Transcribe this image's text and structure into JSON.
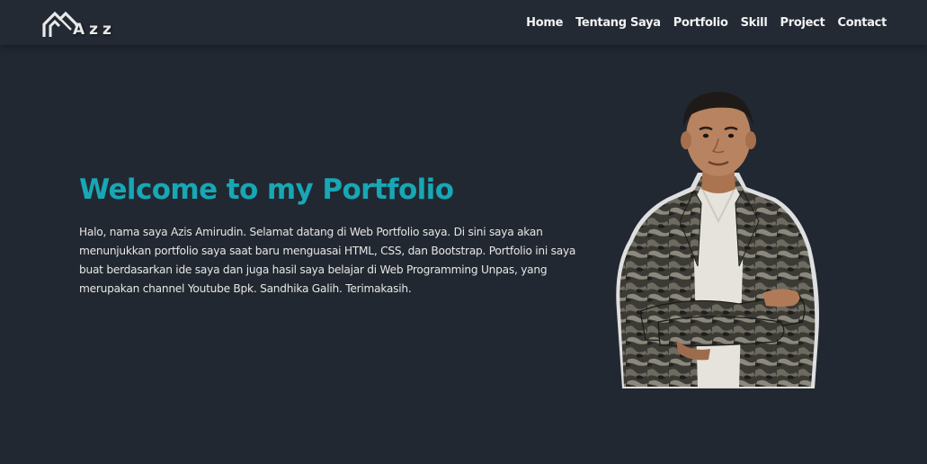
{
  "brand": {
    "text": "Azz",
    "icon": "house-roof-logo-icon"
  },
  "nav": {
    "items": [
      {
        "label": "Home"
      },
      {
        "label": "Tentang Saya"
      },
      {
        "label": "Portfolio"
      },
      {
        "label": "Skill"
      },
      {
        "label": "Project"
      },
      {
        "label": "Contact"
      }
    ]
  },
  "hero": {
    "title": "Welcome to my Portfolio",
    "text": "Halo, nama saya Azis Amirudin. Selamat datang di Web Portfolio saya. Di sini saya akan menunjukkan portfolio saya saat baru menguasai HTML, CSS, dan Bootstrap. Portfolio ini saya buat berdasarkan ide saya dan juga hasil saya belajar di Web Programming Unpas, yang merupakan channel Youtube Bpk. Sandhika Galih. Terimakasih.",
    "photo": "profile-photo"
  },
  "colors": {
    "background": "#222831",
    "navbar": "#232a34",
    "accent": "#17a7b5",
    "text": "#e6e6e6"
  }
}
